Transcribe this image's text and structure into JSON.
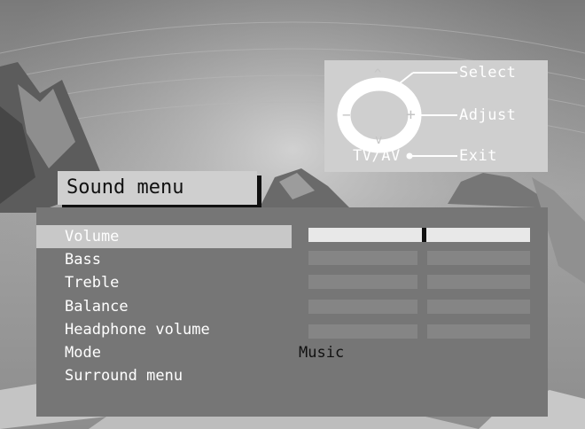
{
  "remote_hint": {
    "select_label": "Select",
    "adjust_label": "Adjust",
    "exit_label": "Exit",
    "source_label": "TV/AV",
    "minus_glyph": "−",
    "plus_glyph": "+",
    "up_glyph": "^",
    "down_glyph": "v"
  },
  "menu": {
    "title": "Sound menu",
    "items": [
      {
        "label": "Volume",
        "selected": true,
        "slider_level": 0.52
      },
      {
        "label": "Bass",
        "slider_level": null
      },
      {
        "label": "Treble",
        "slider_level": null
      },
      {
        "label": "Balance",
        "slider_level": null
      },
      {
        "label": "Headphone volume",
        "slider_level": null
      },
      {
        "label": "Mode",
        "value": "Music"
      },
      {
        "label": "Surround menu"
      }
    ]
  },
  "colors": {
    "panel": "#767676",
    "highlight": "#c8c8c8",
    "text": "#ffffff",
    "value_text": "#111111"
  }
}
